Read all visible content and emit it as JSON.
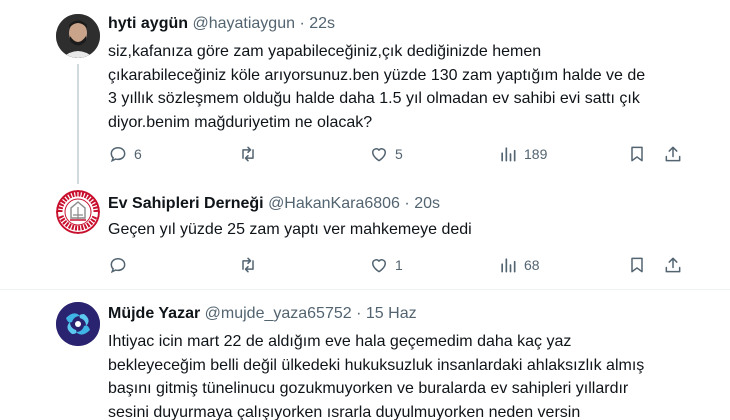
{
  "tweets": [
    {
      "name": "hyti aygün",
      "handle": "@hayatiaygun",
      "dot": "·",
      "time": "22s",
      "lines": [
        "siz,kafanıza göre zam yapabileceğiniz,çık dediğinizde hemen",
        "çıkarabileceğiniz köle arıyorsunuz.ben yüzde 130 zam yaptığım halde ve de",
        "3 yıllık sözleşmem olduğu halde daha 1.5 yıl olmadan ev sahibi evi sattı çık",
        "diyor.benim mağduriyetim ne olacak?"
      ],
      "replies": "6",
      "retweets": "",
      "likes": "5",
      "views": "189"
    },
    {
      "name": "Ev Sahipleri Derneği",
      "handle": "@HakanKara6806",
      "dot": "·",
      "time": "20s",
      "lines": [
        "Geçen yıl yüzde 25 zam yaptı ver mahkemeye dedi"
      ],
      "replies": "",
      "retweets": "",
      "likes": "1",
      "views": "68",
      "logo_text_top": "EV SAHİPLERİ",
      "logo_text_bottom": "ADALET ARIYOR"
    },
    {
      "name": "Müjde Yazar",
      "handle": "@mujde_yaza65752",
      "dot": "·",
      "time": "15 Haz",
      "lines": [
        "Ihtiyac icin mart 22 de aldığım eve hala geçemedim daha kaç yaz",
        "bekleyeceğim belli değil ülkedeki hukuksuzluk insanlardaki ahlaksızlık almış",
        "başını gitmiş tünelinucu gozukmuyorken ve buralarda ev sahipleri yıllardır",
        "sesini duyurmaya çalışıyorken ısrarla duyulmuyorken neden versin"
      ]
    }
  ],
  "colors": {
    "text": "#0f1419",
    "muted": "#536471",
    "thread_line": "#cfd9de",
    "divider": "#eff3f4",
    "logo_red": "#c8102e",
    "avatar3_bg": "#2a2470",
    "avatar3_fg": "#3fb4e6"
  },
  "icons": [
    "reply-icon",
    "retweet-icon",
    "like-icon",
    "views-icon",
    "bookmark-icon",
    "share-icon"
  ]
}
